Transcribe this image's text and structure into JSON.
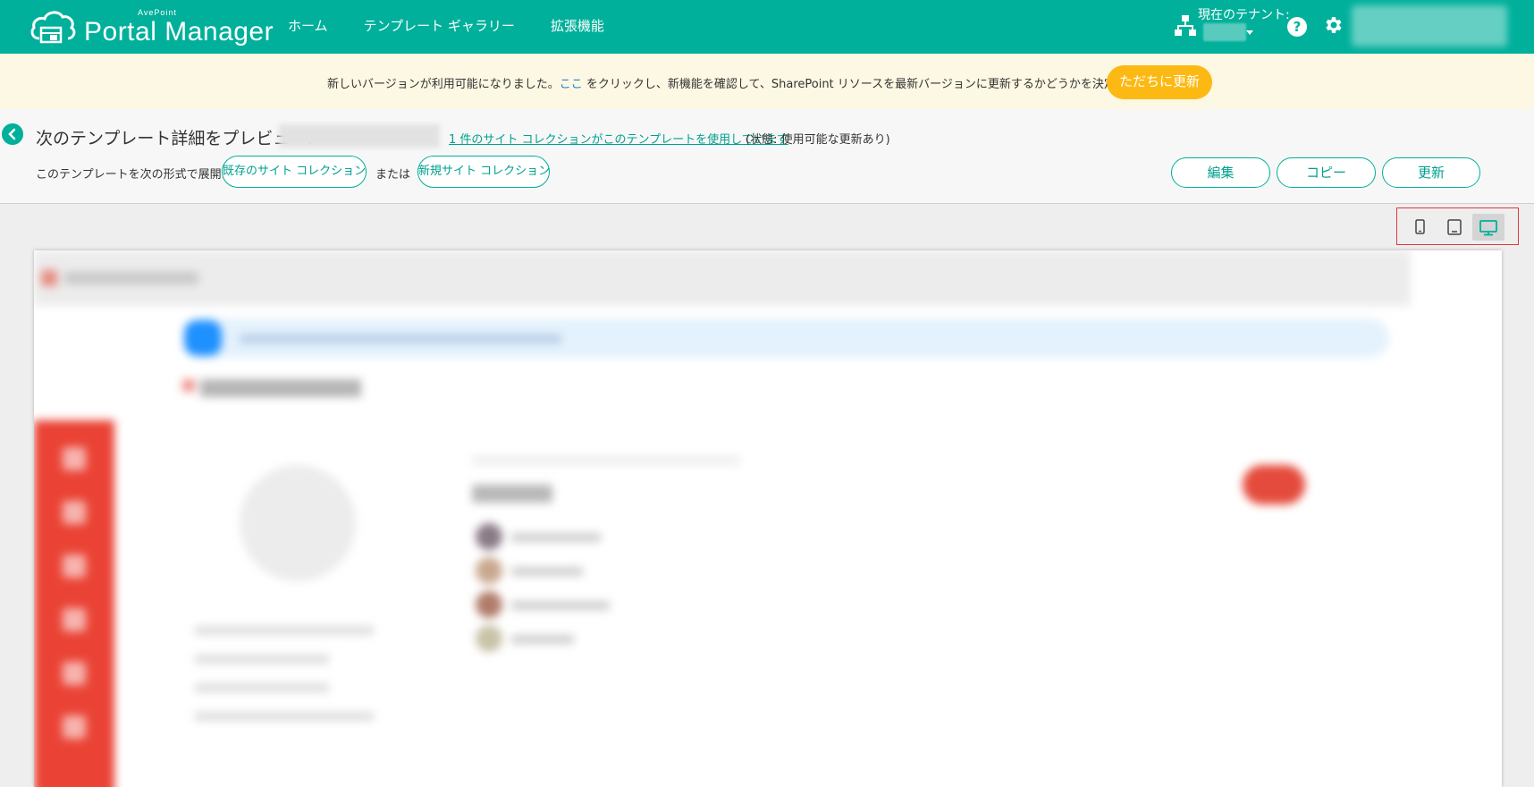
{
  "app": {
    "brand": "AvePoint",
    "product": "Portal Manager"
  },
  "nav": {
    "items": [
      {
        "label": "ホーム"
      },
      {
        "label": "テンプレート ギャラリー"
      },
      {
        "label": "拡張機能"
      }
    ]
  },
  "tenant": {
    "label": "現在のテナント:"
  },
  "banner": {
    "text_before": "新しいバージョンが利用可能になりました。",
    "link": "ここ",
    "text_after": " をクリックし、新機能を確認して、SharePoint リソースを最新バージョンに更新するかどうかを決定してください。",
    "button": "ただちに更新"
  },
  "template": {
    "title": "次のテンプレート詳細をプレビュー:",
    "usage_link": "1 件のサイト コレクションがこのテンプレートを使用しています",
    "status": "(状態: 使用可能な更新あり)",
    "deploy_label": "このテンプレートを次の形式で展開:",
    "existing_button": "既存のサイト コレクション",
    "or_label": "または",
    "new_button": "新規サイト コレクション",
    "edit_button": "編集",
    "copy_button": "コピー",
    "update_button": "更新"
  },
  "device_toggle": {
    "selected": "desktop",
    "options": [
      "mobile",
      "tablet",
      "desktop"
    ]
  },
  "colors": {
    "primary": "#00b09b",
    "banner_bg": "#fdf8e3",
    "update_button": "#fdb913",
    "link": "#1e7fd0",
    "highlight_border": "#e0383e"
  }
}
